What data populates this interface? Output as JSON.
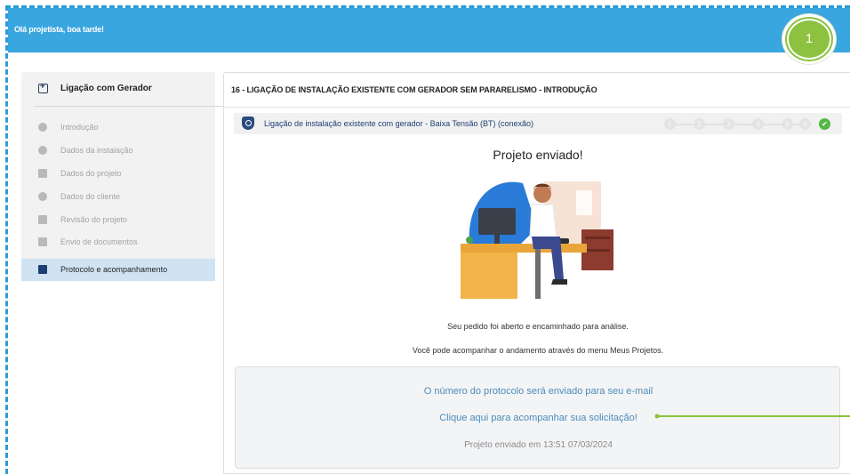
{
  "header": {
    "greeting": "Olá projetista, boa tarde!",
    "callout_number": "1",
    "accent_color": "#3aa6df",
    "callout_color": "#8cc23f"
  },
  "sidebar": {
    "title": "Ligação com Gerador",
    "title_icon": "plus-square-icon",
    "items": [
      {
        "label": "Introdução",
        "icon": "info-circle-icon",
        "state": "disabled"
      },
      {
        "label": "Dados da instalação",
        "icon": "lightbulb-icon",
        "state": "disabled"
      },
      {
        "label": "Dados do projeto",
        "icon": "document-icon",
        "state": "disabled"
      },
      {
        "label": "Dados do cliente",
        "icon": "user-circle-icon",
        "state": "disabled"
      },
      {
        "label": "Revisão do projeto",
        "icon": "list-icon",
        "state": "disabled"
      },
      {
        "label": "Envio de documentos",
        "icon": "file-upload-icon",
        "state": "disabled"
      },
      {
        "label": "Protocolo e acompanhamento",
        "icon": "inbox-icon",
        "state": "active"
      }
    ]
  },
  "main": {
    "title": "16 - LIGAÇÃO DE INSTALAÇÃO EXISTENTE COM GERADOR SEM PARARELISMO - INTRODUÇÃO",
    "step_label": "Ligação de instalação existente com gerador - Baixa Tensão (BT) (conexão)",
    "step_icon": "shield-icon",
    "steps": [
      "1",
      "2",
      "3",
      "4",
      "5",
      "6",
      "✔"
    ],
    "headline": "Projeto enviado!",
    "message_1": "Seu pedido foi aberto e encaminhado para análise.",
    "message_2": "Você pode acompanhar o andamento através do menu Meus Projetos.",
    "protocol_info": "O número do protocolo será enviado para seu e-mail",
    "tracking_link": "Clique aqui para acompanhar sua solicitação!",
    "sent_at": "Projeto enviado em 13:51 07/03/2024"
  }
}
